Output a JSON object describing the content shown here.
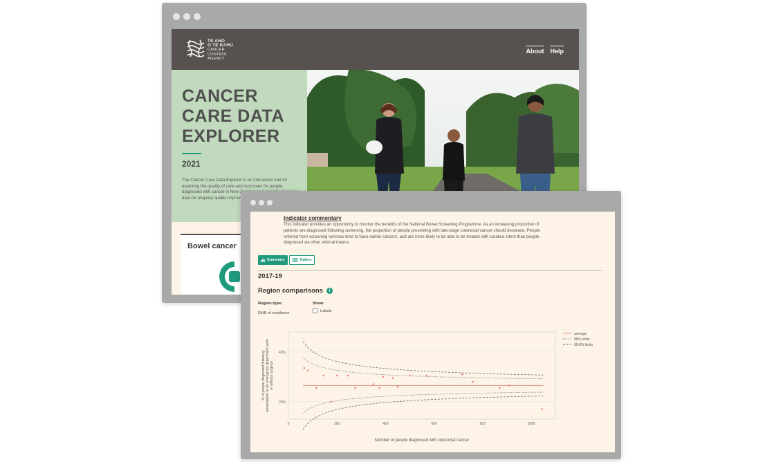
{
  "back_window": {
    "logo": {
      "line1": "TE AHO",
      "line2": "O TE KAHU",
      "line3": "CANCER",
      "line4": "CONTROL",
      "line5": "AGENCY"
    },
    "nav": [
      "About",
      "Help"
    ],
    "hero": {
      "title": "CANCER CARE DATA EXPLORER",
      "year": "2021",
      "description": "The Cancer Care Data Explorer is an interactive tool for exploring the quality of care and outcomes for people diagnosed with cancer in New Zealand and provides baseline data for ongoing quality improvement."
    },
    "card": {
      "label": "Bowel cancer"
    }
  },
  "front_window": {
    "commentary": {
      "title": "Indicator commentary",
      "text": "This indicator provides an opportunity to monitor the benefits of the National Bowel Screening Programme. As an increasing proportion of patients are diagnosed following screening, the proportion of people presenting with late-stage colorectal cancer should decrease. People referred from screening services tend to have earlier cancers, and are more likely to be able to be treated with curative intent than people diagnosed via other referral means."
    },
    "tabs": {
      "summary": "Summary",
      "tables": "Tables"
    },
    "period": "2017-19",
    "region_title": "Region comparisons",
    "info_glyph": "i",
    "controls": {
      "region_type_label": "Region type:",
      "region_type_value": "DHB of residence",
      "show_label": "Show",
      "labels_option": "Labels"
    }
  },
  "colors": {
    "accent": "#1f9a7d",
    "header": "#575250",
    "hero_green": "#c1d9bd",
    "average_line": "#e8847a",
    "limits": "#666666"
  },
  "chart_data": {
    "type": "scatter",
    "xlabel": "Number of people diagnosed with colorectal cancer",
    "ylabel": "% of people diagnosed following presentation to an emergency department (with or without surgery)",
    "xlim": [
      0,
      1100
    ],
    "ylim": [
      13,
      48
    ],
    "x_ticks": [
      0,
      200,
      400,
      600,
      800,
      1000
    ],
    "y_ticks": [
      {
        "value": 20,
        "label": "20%"
      },
      {
        "value": 40,
        "label": "40%"
      }
    ],
    "legend": [
      "average",
      "95% limits",
      "99.8% limits"
    ],
    "legend_position": "right",
    "average": 26.5,
    "points": [
      {
        "x": 65,
        "y": 33.5
      },
      {
        "x": 80,
        "y": 32.5
      },
      {
        "x": 115,
        "y": 25.5
      },
      {
        "x": 145,
        "y": 30.5
      },
      {
        "x": 175,
        "y": 20
      },
      {
        "x": 200,
        "y": 30.5
      },
      {
        "x": 245,
        "y": 30.5
      },
      {
        "x": 275,
        "y": 25.5
      },
      {
        "x": 350,
        "y": 27
      },
      {
        "x": 375,
        "y": 25.5
      },
      {
        "x": 390,
        "y": 30
      },
      {
        "x": 430,
        "y": 29.5
      },
      {
        "x": 450,
        "y": 26
      },
      {
        "x": 500,
        "y": 30.5
      },
      {
        "x": 570,
        "y": 30.5
      },
      {
        "x": 715,
        "y": 31
      },
      {
        "x": 760,
        "y": 28
      },
      {
        "x": 870,
        "y": 25.5
      },
      {
        "x": 910,
        "y": 26.5
      },
      {
        "x": 1045,
        "y": 17
      }
    ]
  }
}
